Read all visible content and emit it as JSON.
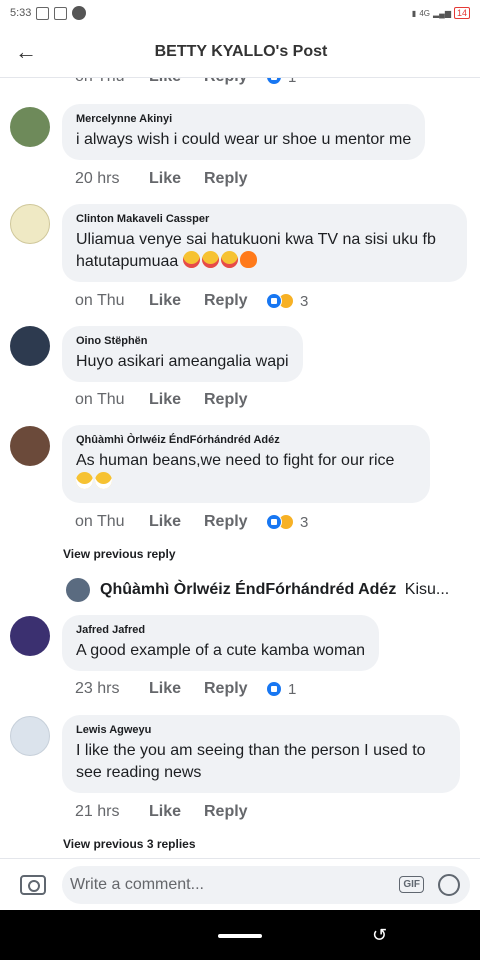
{
  "status_bar": {
    "time": "5:33",
    "network": "4G",
    "battery": "14"
  },
  "header": {
    "title": "BETTY KYALLO's Post",
    "back_icon": "arrow-left-icon"
  },
  "actions": {
    "like": "Like",
    "reply": "Reply"
  },
  "top_partial": {
    "time": "on Thu",
    "reactions": "1"
  },
  "comments": [
    {
      "name": "Mercelynne Akinyi",
      "text": "i always wish i could wear ur shoe u mentor me",
      "time": "20 hrs",
      "reactions": ""
    },
    {
      "name": "Clinton Makaveli Cassper",
      "text": "Uliamua venye sai hatukuoni kwa TV na sisi uku fb hatutapumuaa",
      "time": "on Thu",
      "reactions": "3"
    },
    {
      "name": "Oino Stëphën",
      "text": "Huyo asikari ameangalia wapi",
      "time": "on Thu",
      "reactions": ""
    },
    {
      "name": "Qhûàmhì Òrlwéiz ÉndFórhándréd Adéz",
      "text": "As human beans,we need to fight for our rice",
      "time": "on Thu",
      "reactions": "3"
    },
    {
      "name": "Jafred Jafred",
      "text": "A good example of a cute kamba woman",
      "time": "23 hrs",
      "reactions": "1"
    },
    {
      "name": "Lewis Agweyu",
      "text": "I like the you am seeing than the person I used to see reading news",
      "time": "21 hrs",
      "reactions": ""
    }
  ],
  "view_previous_reply": "View previous reply",
  "sub_reply": {
    "name": "Qhûàmhì Òrlwéiz ÉndFórhándréd Adéz",
    "preview": "Kisu..."
  },
  "view_previous_3": "View previous 3 replies",
  "composer": {
    "placeholder": "Write a comment...",
    "gif": "GIF"
  }
}
